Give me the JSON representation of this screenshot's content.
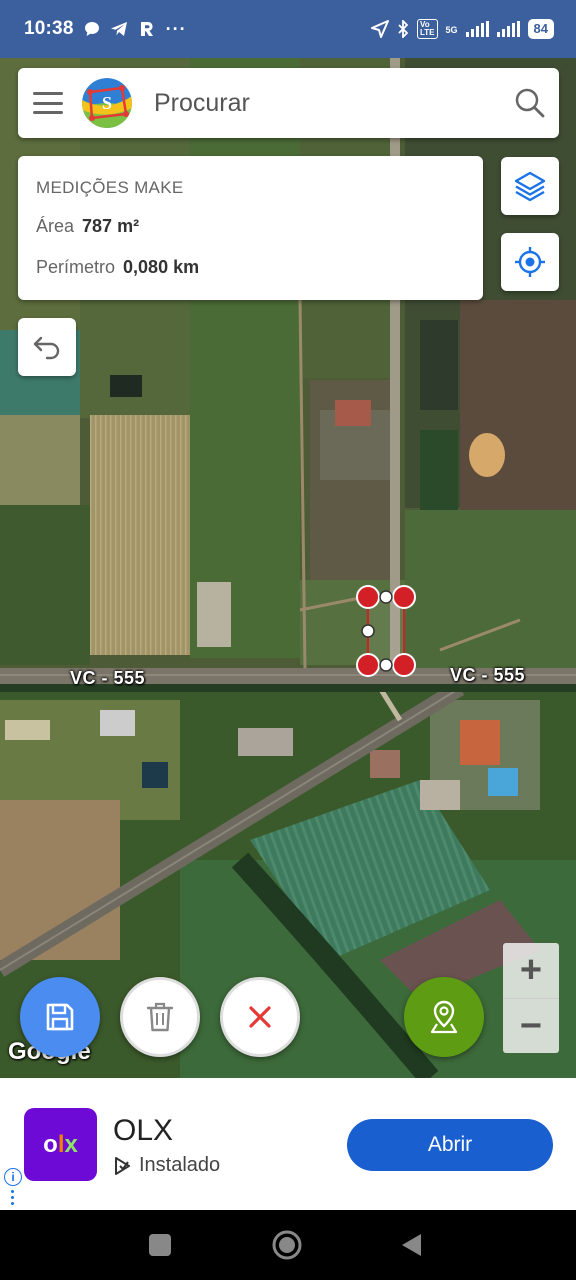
{
  "status_bar": {
    "time": "10:38",
    "battery": "84",
    "network": "5G"
  },
  "search": {
    "placeholder": "Procurar",
    "logo_letter": "S"
  },
  "measurement": {
    "title": "MEDIÇÕES MAKE",
    "area_label": "Área",
    "area_value": "787 m²",
    "perimeter_label": "Perímetro",
    "perimeter_value": "0,080 km"
  },
  "map": {
    "road_label_left": "VC - 555",
    "road_label_right": "VC - 555",
    "attribution": "Google"
  },
  "zoom": {
    "in_label": "+",
    "out_label": "−"
  },
  "fabs": {
    "save_color": "#4a8cf0",
    "delete_color": "#ffffff",
    "cancel_color": "#ffffff",
    "cancel_icon_color": "#e53935",
    "location_color": "#5e9c13"
  },
  "ad": {
    "app_name": "OLX",
    "status": "Instalado",
    "button_label": "Abrir",
    "button_color": "#1a5fd0",
    "logo_text_o": "o",
    "logo_text_l": "l",
    "logo_text_x": "x"
  },
  "colors": {
    "status_bar": "#3c5f9e",
    "accent_blue": "#1a73e8",
    "marker_red": "#d32027"
  }
}
